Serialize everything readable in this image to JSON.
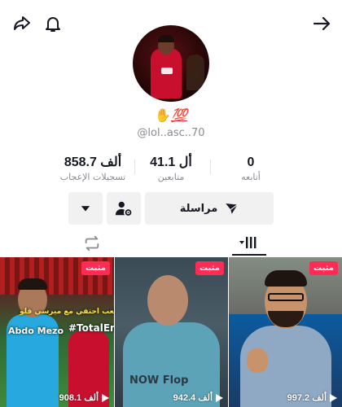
{
  "header": {
    "back_icon": "arrow-right-icon",
    "share_icon": "share-icon",
    "bell_icon": "bell-icon"
  },
  "profile": {
    "bio_hand": "✋",
    "bio_hundred": "💯",
    "username": "@lol..asc..70"
  },
  "stats": [
    {
      "value": "858.7 ألف",
      "label": "تسجيلات الإعجاب"
    },
    {
      "value": "41.1 أل",
      "label": "متابعين"
    },
    {
      "value": "0",
      "label": "أتابعه"
    }
  ],
  "actions": {
    "message_label": "مراسلة"
  },
  "videos": [
    {
      "badge": "مثبت",
      "views": "997.2 ألف"
    },
    {
      "badge": "مثبت",
      "views": "942.4 ألف"
    },
    {
      "badge": "مثبت",
      "views": "908.1 ألف",
      "caption_top": "نلعب احتفي مع ميرسي فلو",
      "caption_name": "Abdo Mezo",
      "caption_brand": "#TotalEne"
    }
  ],
  "videos_misc": {
    "shirt_text": "NOW Flop"
  },
  "colors": {
    "accent": "#fe2c55",
    "text": "#161823",
    "muted": "#8a8b91"
  }
}
